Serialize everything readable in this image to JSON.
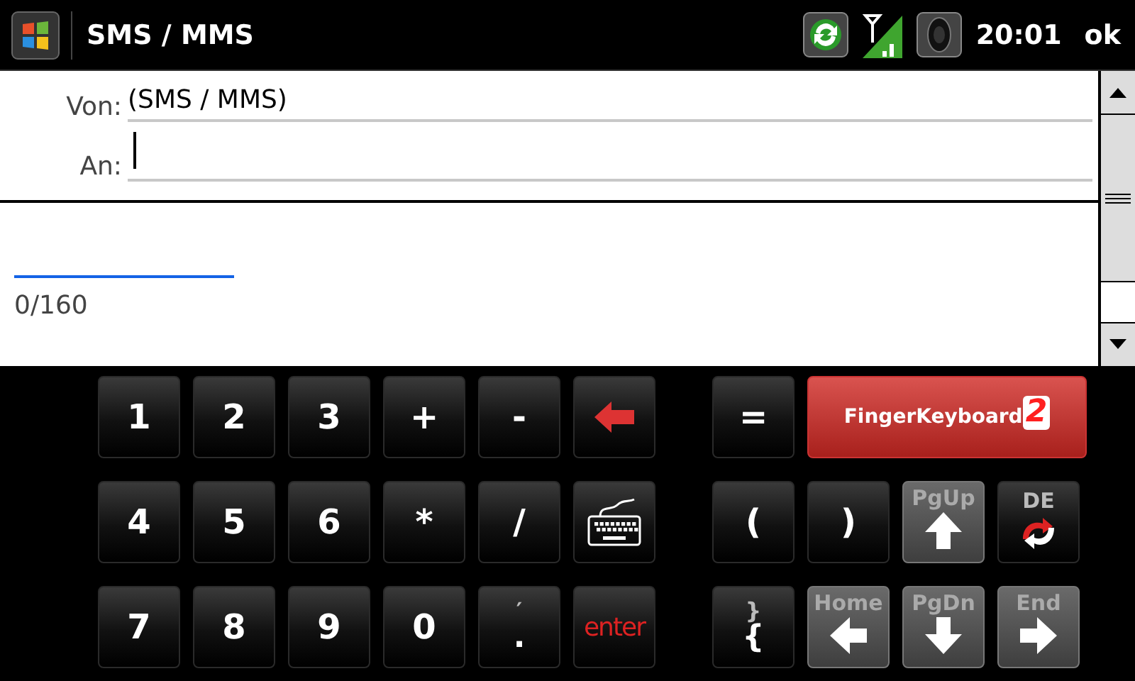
{
  "title_bar": {
    "title": "SMS / MMS",
    "time": "20:01",
    "ok": "ok"
  },
  "form": {
    "fields": [
      {
        "label": "Von:",
        "value": "(SMS / MMS)",
        "focused": false
      },
      {
        "label": "An:",
        "focused": true
      }
    ]
  },
  "message": {
    "counter": "0/160"
  },
  "keyboard": {
    "left_rows": [
      [
        {
          "kind": "char",
          "label": "1"
        },
        {
          "kind": "char",
          "label": "2"
        },
        {
          "kind": "char",
          "label": "3"
        },
        {
          "kind": "char",
          "label": "+"
        },
        {
          "kind": "char",
          "label": "-"
        },
        {
          "kind": "backspace"
        }
      ],
      [
        {
          "kind": "char",
          "label": "4"
        },
        {
          "kind": "char",
          "label": "5"
        },
        {
          "kind": "char",
          "label": "6"
        },
        {
          "kind": "char",
          "label": "*"
        },
        {
          "kind": "char",
          "label": "/"
        },
        {
          "kind": "keyboard"
        }
      ],
      [
        {
          "kind": "char",
          "label": "7"
        },
        {
          "kind": "char",
          "label": "8"
        },
        {
          "kind": "char",
          "label": "9"
        },
        {
          "kind": "char",
          "label": "0"
        },
        {
          "kind": "stacked",
          "top": "′",
          "label": "."
        },
        {
          "kind": "enter",
          "label": "enter"
        }
      ]
    ],
    "right_rows": [
      [
        {
          "kind": "char",
          "label": "="
        },
        {
          "kind": "brand",
          "label": "FingerKeyboard",
          "suffix": "2"
        }
      ],
      [
        {
          "kind": "char",
          "label": "("
        },
        {
          "kind": "char",
          "label": ")"
        },
        {
          "kind": "up",
          "label": "PgUp"
        },
        {
          "kind": "lang",
          "label": "DE"
        }
      ],
      [
        {
          "kind": "stacked",
          "top": "}",
          "label": "{"
        },
        {
          "kind": "left",
          "label": "Home"
        },
        {
          "kind": "down",
          "label": "PgDn"
        },
        {
          "kind": "right",
          "label": "End"
        }
      ]
    ]
  }
}
